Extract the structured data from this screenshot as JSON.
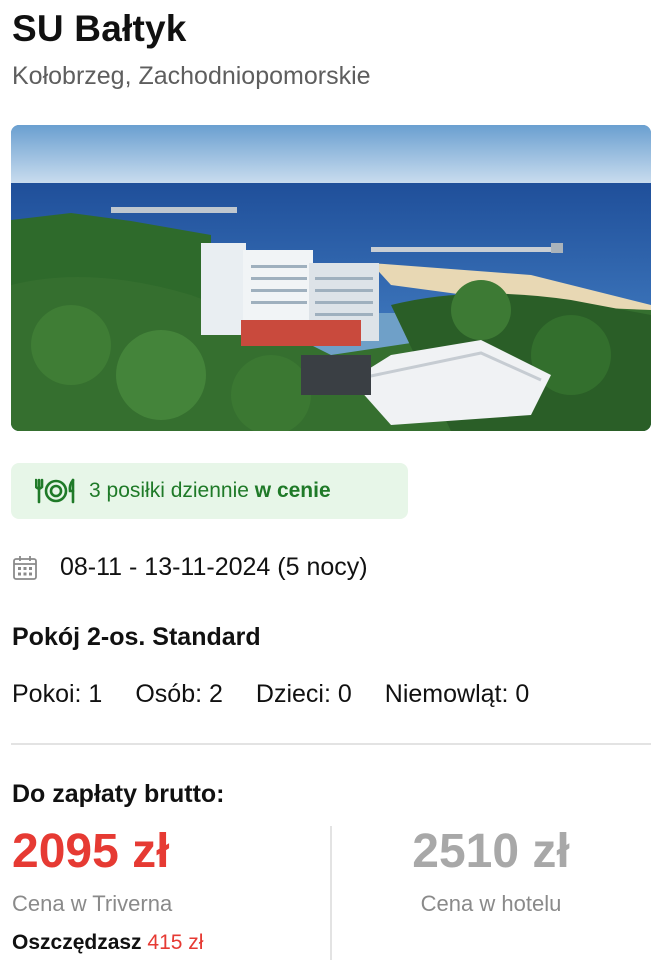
{
  "hotel": {
    "name": "SU Bałtyk",
    "location": "Kołobrzeg, Zachodniopomorskie"
  },
  "hero_image": {
    "description_icon": "hotel-photo"
  },
  "meals_badge": {
    "icon": "cutlery-plate-icon",
    "text_prefix": "3 posiłki dziennie",
    "text_bold": "w cenie",
    "bg_color": "#e7f6e8",
    "text_color": "#1f7a28"
  },
  "stay": {
    "icon": "calendar-icon",
    "dates": "08-11 - 13-11-2024 (5 nocy)"
  },
  "room": {
    "type": "Pokój 2-os. Standard",
    "counts": [
      {
        "label": "Pokoi: 1"
      },
      {
        "label": "Osób: 2"
      },
      {
        "label": "Dzieci: 0"
      },
      {
        "label": "Niemowląt: 0"
      }
    ]
  },
  "payment": {
    "label": "Do zapłaty brutto:",
    "triverna_price": "2095 zł",
    "triverna_caption": "Cena w Triverna",
    "savings_label": "Oszczędzasz",
    "savings_amount": "415 zł",
    "hotel_price": "2510 zł",
    "hotel_caption": "Cena w hotelu",
    "accent_color": "#e63a33"
  }
}
